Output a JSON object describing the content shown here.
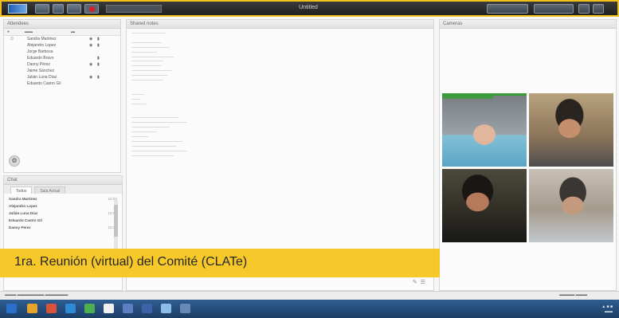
{
  "caption": "1ra. Reunión (virtual) del Comité (CLATe)",
  "topbar": {
    "window_title": "Untitled"
  },
  "attendees": {
    "header": "Attendees",
    "rows": [
      {
        "name": "Sandra Martinez",
        "mic": true,
        "cam": true
      },
      {
        "name": "Alejandro Lopez",
        "mic": true,
        "cam": true
      },
      {
        "name": "Jorge Barbosa",
        "mic": false,
        "cam": false
      },
      {
        "name": "Eduardo Bravo",
        "mic": false,
        "cam": true
      },
      {
        "name": "Danny Pérez",
        "mic": true,
        "cam": true
      },
      {
        "name": "Jaime Sánchez",
        "mic": false,
        "cam": false
      },
      {
        "name": "Julián Luna Díaz",
        "mic": true,
        "cam": true
      },
      {
        "name": "Eduardo Castro Gil",
        "mic": false,
        "cam": false
      }
    ]
  },
  "chat": {
    "header": "Chat",
    "tabs": [
      "Todos",
      "Sala Actual"
    ],
    "messages": [
      {
        "author": "Sandra Martinez",
        "time": "10:04"
      },
      {
        "author": "Alejandro Lopez",
        "time": ""
      },
      {
        "author": "Julián Luna Díaz",
        "time": "10:05"
      },
      {
        "author": "Eduardo Castro Gil",
        "time": ""
      },
      {
        "author": "Danny Pérez",
        "time": "10:06"
      }
    ]
  },
  "notes": {
    "header": "Shared notes"
  },
  "video": {
    "header": "Cameras"
  },
  "colors": {
    "caption_band": "#f6c419",
    "frame_border": "#f2c21a",
    "active_speaker": "#3a9d35"
  }
}
